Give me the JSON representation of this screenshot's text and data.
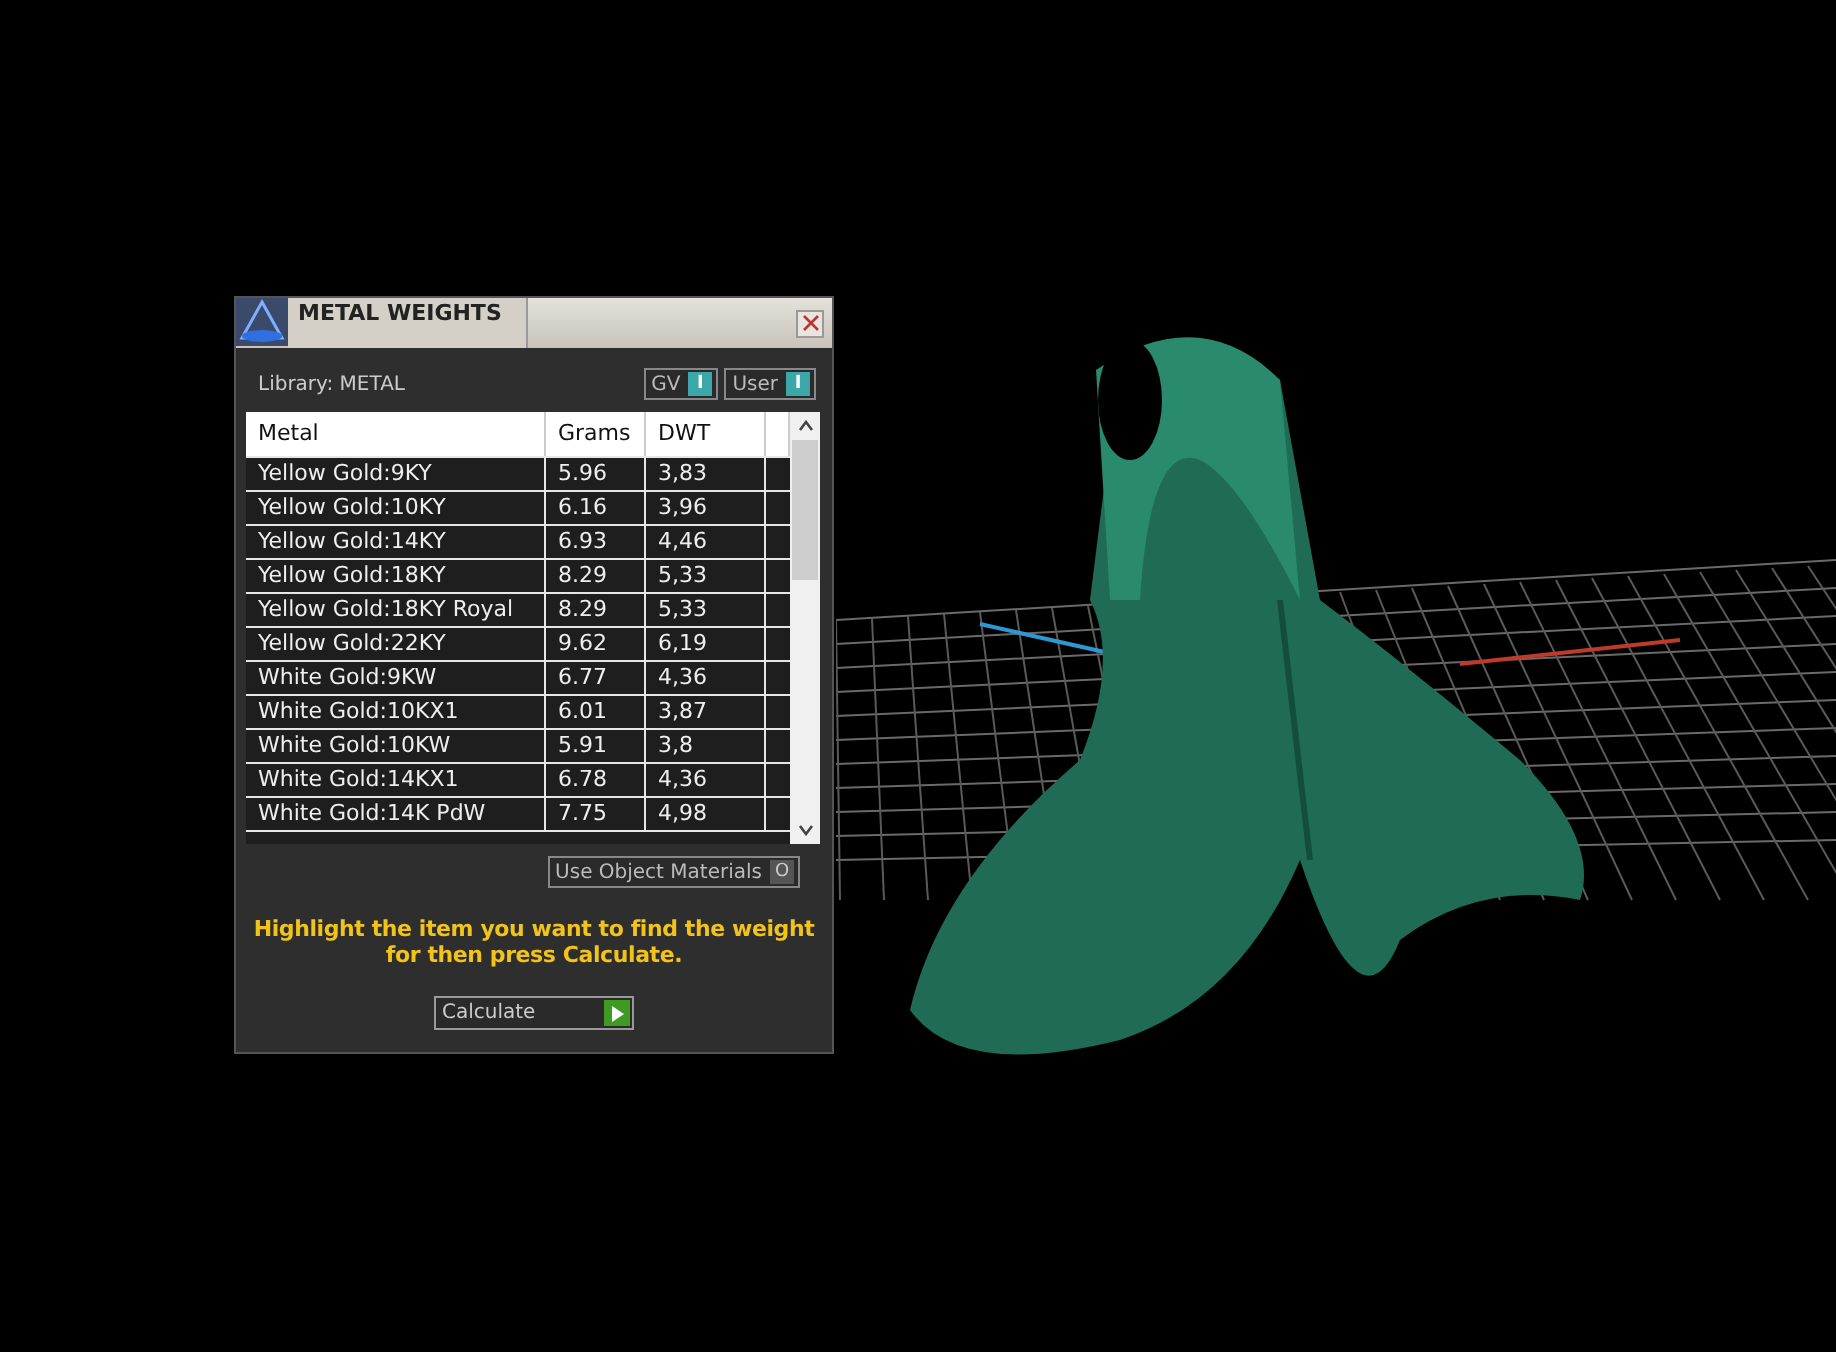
{
  "panel": {
    "title": "METAL WEIGHTS",
    "library": "Library: METAL",
    "toggles": [
      {
        "label": "GV",
        "indicator": "I",
        "on": true
      },
      {
        "label": "User",
        "indicator": "I",
        "on": true
      }
    ],
    "table": {
      "columns": [
        "Metal",
        "Grams",
        "DWT"
      ],
      "rows": [
        {
          "cells": [
            "Yellow Gold:9KY",
            "5.96",
            "3,83"
          ]
        },
        {
          "cells": [
            "Yellow Gold:10KY",
            "6.16",
            "3,96"
          ]
        },
        {
          "cells": [
            "Yellow Gold:14KY",
            "6.93",
            "4,46"
          ]
        },
        {
          "cells": [
            "Yellow Gold:18KY",
            "8.29",
            "5,33"
          ]
        },
        {
          "cells": [
            "Yellow Gold:18KY Royal",
            "8.29",
            "5,33"
          ]
        },
        {
          "cells": [
            "Yellow Gold:22KY",
            "9.62",
            "6,19"
          ]
        },
        {
          "cells": [
            "White Gold:9KW",
            "6.77",
            "4,36"
          ]
        },
        {
          "cells": [
            "White Gold:10KX1",
            "6.01",
            "3,87"
          ]
        },
        {
          "cells": [
            "White Gold:10KW",
            "5.91",
            "3,8"
          ]
        },
        {
          "cells": [
            "White Gold:14KX1",
            "6.78",
            "4,36"
          ]
        },
        {
          "cells": [
            "White Gold:14K PdW",
            "7.75",
            "4,98"
          ]
        }
      ]
    },
    "use_object_materials": {
      "label": "Use Object Materials",
      "indicator": "O",
      "on": false
    },
    "hint": "Highlight the item you want to find the weight for then press Calculate.",
    "calculate_button": "Calculate"
  }
}
